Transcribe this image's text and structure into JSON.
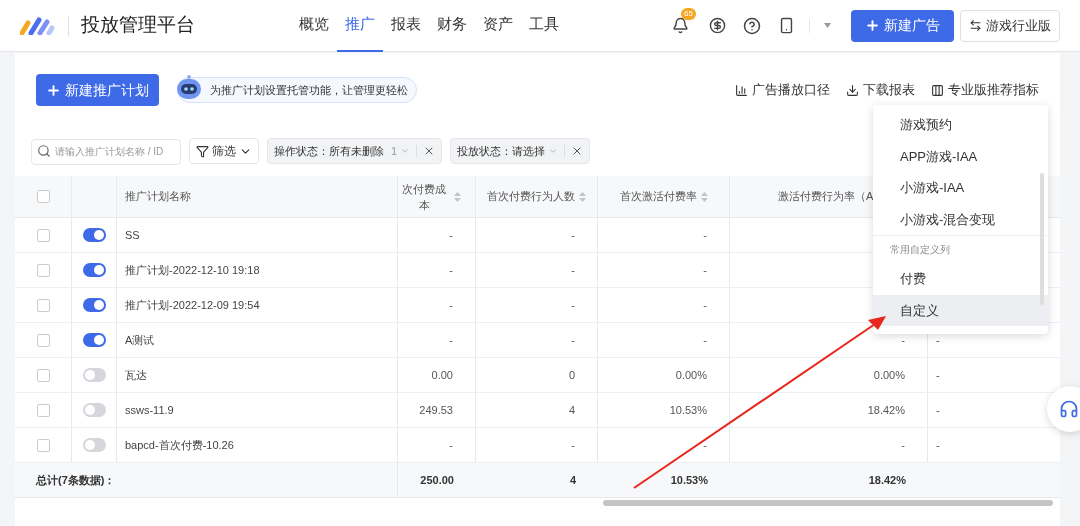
{
  "header": {
    "title": "投放管理平台",
    "nav": [
      {
        "label": "概览",
        "selected": false
      },
      {
        "label": "推广",
        "selected": true
      },
      {
        "label": "报表",
        "selected": false
      },
      {
        "label": "财务",
        "selected": false
      },
      {
        "label": "资产",
        "selected": false
      },
      {
        "label": "工具",
        "selected": false
      }
    ],
    "notification_badge": "65",
    "new_ad_button": "新建广告",
    "industry_button": "游戏行业版"
  },
  "toolbar": {
    "new_plan_button": "新建推广计划",
    "assistant_tip": "为推广计划设置托管功能，让管理更轻松",
    "links": [
      "广告播放口径",
      "下载报表",
      "专业版推荐指标"
    ]
  },
  "filters": {
    "search": {
      "placeholder": "请输入推广计划名称 / ID"
    },
    "filter_button": "筛选",
    "tags": [
      {
        "label": "操作状态：所有未删除",
        "count": "1"
      },
      {
        "label": "投放状态：请选择"
      }
    ]
  },
  "table": {
    "all_checked": false,
    "columns": [
      {
        "label": "推广计划名称",
        "sortable": false
      },
      {
        "label": "次付费成本",
        "sortable": true
      },
      {
        "label": "首次付费行为人数",
        "sortable": true
      },
      {
        "label": "首次激活付费率",
        "sortable": true
      },
      {
        "label": "激活付费行为率（A",
        "sortable": false
      }
    ],
    "rows": [
      {
        "checked": false,
        "on": true,
        "cells": [
          "SS",
          "-",
          "-",
          "-",
          null,
          null
        ]
      },
      {
        "checked": false,
        "on": true,
        "cells": [
          "推广计划-2022-12-10 19:18",
          "-",
          "-",
          "-",
          null,
          null
        ]
      },
      {
        "checked": false,
        "on": true,
        "cells": [
          "推广计划-2022-12-09 19:54",
          "-",
          "-",
          "-",
          null,
          null
        ]
      },
      {
        "checked": false,
        "on": true,
        "cells": [
          "A测试",
          "-",
          "-",
          "-",
          "-",
          "-"
        ]
      },
      {
        "checked": false,
        "on": false,
        "cells": [
          "瓦达",
          "0.00",
          "0",
          "0.00%",
          "0.00%",
          "-"
        ]
      },
      {
        "checked": false,
        "on": false,
        "cells": [
          "ssws-11.9",
          "249.53",
          "4",
          "10.53%",
          "18.42%",
          "-"
        ]
      },
      {
        "checked": false,
        "on": false,
        "cells": [
          "bapcd-首次付费-10.26",
          "-",
          "-",
          "-",
          "-",
          "-"
        ]
      }
    ],
    "total": {
      "label": "总计(7条数据)：",
      "cells": [
        "250.00",
        "4",
        "10.53%",
        "18.42%"
      ]
    }
  },
  "dropdown_menu": [
    {
      "kind": "item",
      "label": "游戏预约",
      "highlighted": false
    },
    {
      "kind": "item",
      "label": "APP游戏-IAA",
      "highlighted": false
    },
    {
      "kind": "item",
      "label": "小游戏-IAA",
      "highlighted": false
    },
    {
      "kind": "item",
      "label": "小游戏-混合变现",
      "highlighted": false
    },
    {
      "kind": "group",
      "label": "常用自定义列"
    },
    {
      "kind": "item",
      "label": "付费",
      "highlighted": false
    },
    {
      "kind": "item",
      "label": "自定义",
      "highlighted": true
    }
  ]
}
